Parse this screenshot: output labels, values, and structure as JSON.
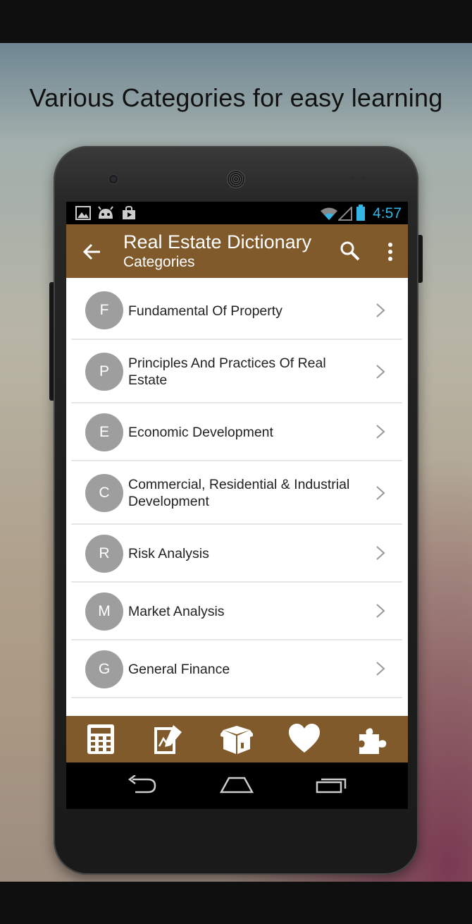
{
  "promo": {
    "title": "Various Categories for easy learning"
  },
  "status_bar": {
    "time": "4:57",
    "left_icons": [
      "image-icon",
      "android-icon",
      "store-icon"
    ],
    "right_icons": [
      "wifi-icon",
      "signal-icon",
      "battery-icon"
    ],
    "accent_color": "#33b5e5"
  },
  "app_bar": {
    "title": "Real Estate Dictionary",
    "subtitle": "Categories",
    "color": "#815a2c",
    "actions": [
      "back-arrow-icon",
      "search-icon",
      "overflow-menu-icon"
    ]
  },
  "categories": [
    {
      "initial": "F",
      "label": "Fundamental Of Property"
    },
    {
      "initial": "P",
      "label": "Principles And Practices Of Real Estate"
    },
    {
      "initial": "E",
      "label": "Economic Development"
    },
    {
      "initial": "C",
      "label": "Commercial, Residential & Industrial Development"
    },
    {
      "initial": "R",
      "label": "Risk Analysis"
    },
    {
      "initial": "M",
      "label": "Market Analysis"
    },
    {
      "initial": "G",
      "label": "General Finance"
    }
  ],
  "bottom_bar": {
    "icons": [
      "calculator-icon",
      "notes-icon",
      "box-icon",
      "heart-icon",
      "puzzle-icon"
    ]
  },
  "nav_bar": {
    "icons": [
      "nav-back-icon",
      "nav-home-icon",
      "nav-recents-icon"
    ]
  }
}
